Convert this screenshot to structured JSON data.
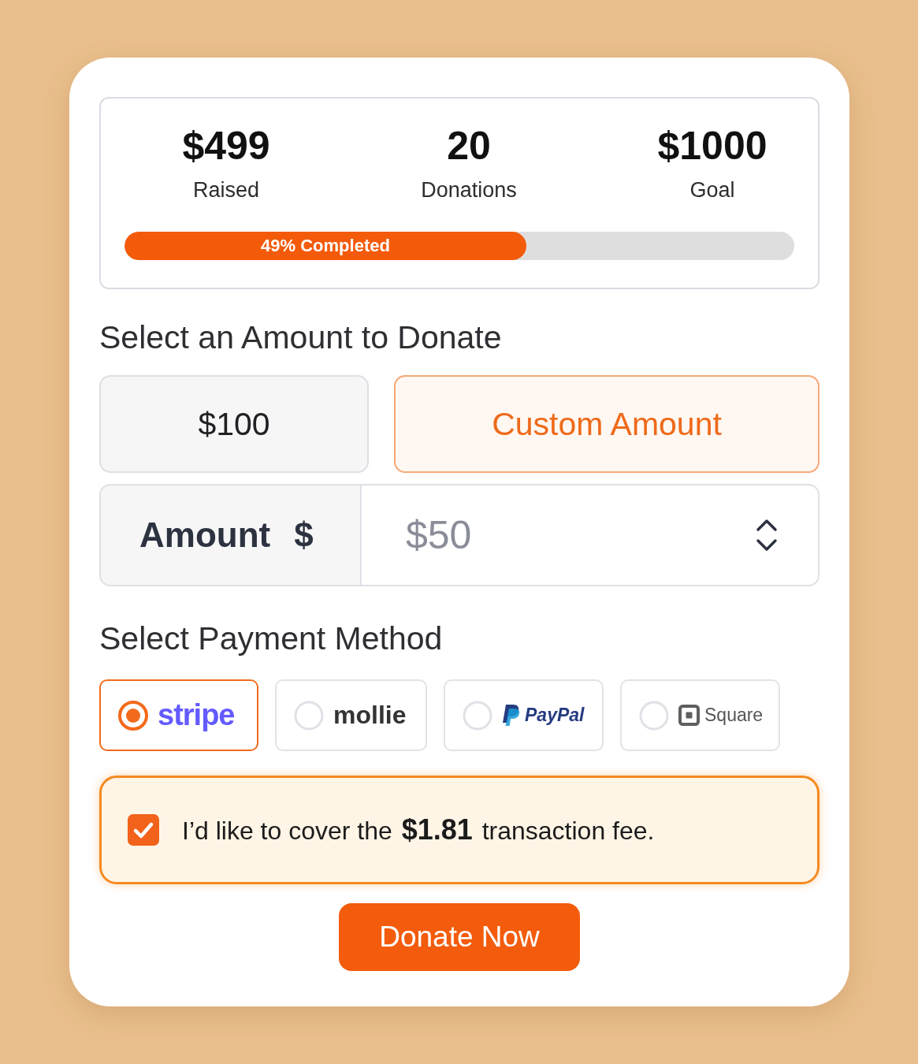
{
  "stats": [
    {
      "value": "$499",
      "label": "Raised"
    },
    {
      "value": "20",
      "label": "Donations"
    },
    {
      "value": "$1000",
      "label": "Goal"
    }
  ],
  "progress": {
    "level": 0.6,
    "label": "49% Completed"
  },
  "amount_section": {
    "title": "Select an Amount to Donate",
    "options": [
      {
        "label": "$100",
        "selected": false
      },
      {
        "label": "Custom Amount",
        "selected": true
      }
    ],
    "amount_field": {
      "label": "Amount",
      "prefix": "$",
      "placeholder": "$50"
    }
  },
  "payment_section": {
    "title": "Select Payment Method",
    "methods": [
      {
        "kind": "stripe",
        "label": "stripe",
        "selected": true
      },
      {
        "kind": "mollie",
        "label": "mollie",
        "selected": false
      },
      {
        "kind": "paypal",
        "label": "PayPal",
        "selected": false
      },
      {
        "kind": "square",
        "label": "Square",
        "selected": false
      }
    ]
  },
  "fee": {
    "checked": true,
    "text": "I’d like to cover the **$1.81** transaction fee."
  },
  "donate_button": "Donate Now"
}
